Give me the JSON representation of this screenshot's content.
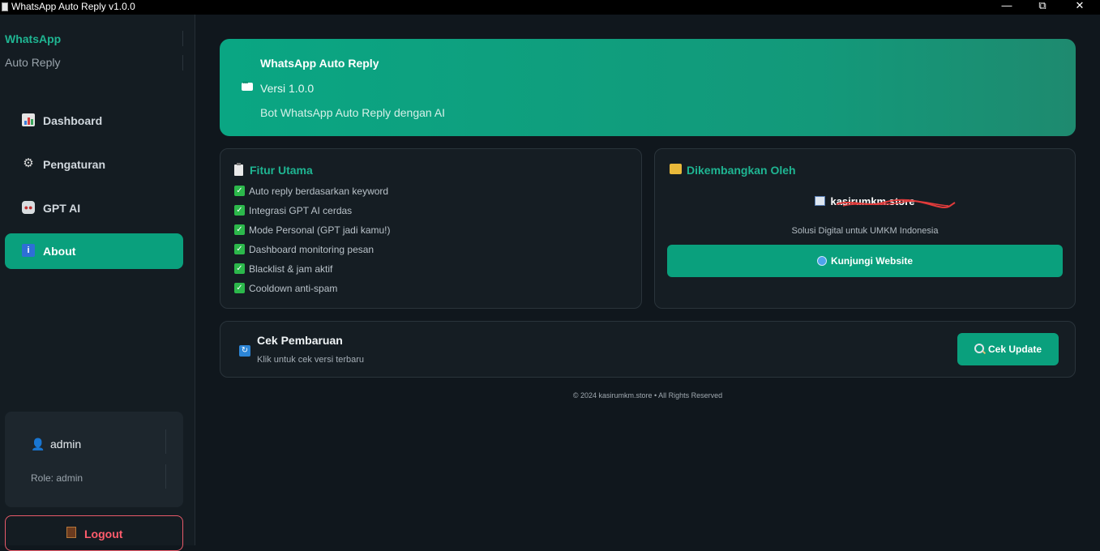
{
  "window": {
    "title": "WhatsApp Auto Reply v1.0.0",
    "controls": {
      "minimize": "—",
      "maximize": "⧉",
      "close": "✕"
    }
  },
  "sidebar": {
    "brand": "WhatsApp",
    "brand_sub": "Auto Reply",
    "nav": [
      {
        "label": "Dashboard",
        "icon": "chart-icon"
      },
      {
        "label": "Pengaturan",
        "icon": "gear-icon"
      },
      {
        "label": "GPT AI",
        "icon": "robot-icon"
      },
      {
        "label": "About",
        "icon": "info-icon",
        "active": true
      }
    ],
    "user": {
      "name": "admin",
      "role": "Role: admin"
    },
    "logout_label": "Logout"
  },
  "hero": {
    "title": "WhatsApp Auto Reply",
    "version": "Versi 1.0.0",
    "description": "Bot WhatsApp Auto Reply dengan AI"
  },
  "features": {
    "title": "Fitur Utama",
    "items": [
      "Auto reply berdasarkan keyword",
      "Integrasi GPT AI cerdas",
      "Mode Personal (GPT jadi kamu!)",
      "Dashboard monitoring pesan",
      "Blacklist & jam aktif",
      "Cooldown anti-spam"
    ]
  },
  "developer": {
    "title": "Dikembangkan Oleh",
    "store": "kasirumkm.store",
    "tagline": "Solusi Digital untuk UMKM Indonesia",
    "visit_label": "Kunjungi Website"
  },
  "update": {
    "title": "Cek Pembaruan",
    "subtitle": "Klik untuk cek versi terbaru",
    "button_label": "Cek Update"
  },
  "footer": "© 2024 kasirumkm.store • All Rights Reserved",
  "colors": {
    "accent": "#0aa07d",
    "brand_text": "#1fb592",
    "logout": "#ff5c6c",
    "background": "#10171d"
  }
}
